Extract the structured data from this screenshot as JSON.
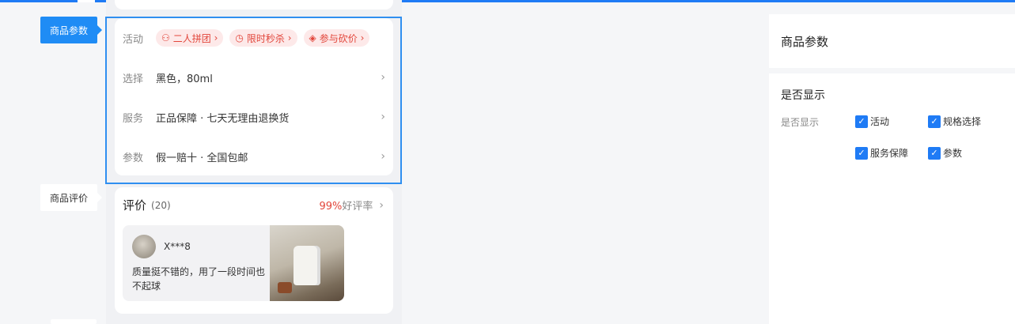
{
  "side_tags": {
    "params": "商品参数",
    "review": "商品评价"
  },
  "params_card": {
    "activity_label": "活动",
    "chips": [
      {
        "icon": "group-icon",
        "label": "二人拼团"
      },
      {
        "icon": "clock-icon",
        "label": "限时秒杀"
      },
      {
        "icon": "tag-icon",
        "label": "参与砍价"
      }
    ],
    "select_label": "选择",
    "select_value": "黑色，80ml",
    "service_label": "服务",
    "service_value": "正品保障 · 七天无理由退换货",
    "param_label": "参数",
    "param_value": "假一赔十 · 全国包邮"
  },
  "review_card": {
    "title": "评价",
    "count": "(20)",
    "rate_pct": "99%",
    "rate_text": "好评率",
    "user": "X***8",
    "text": "质量挺不错的，用了一段时间也不起球"
  },
  "right_panel": {
    "title": "商品参数",
    "section_title": "是否显示",
    "field_label": "是否显示",
    "options": [
      {
        "label": "活动",
        "checked": true
      },
      {
        "label": "规格选择",
        "checked": true
      },
      {
        "label": "服务保障",
        "checked": true
      },
      {
        "label": "参数",
        "checked": true
      }
    ]
  },
  "colors": {
    "accent": "#1f7bf5",
    "selection_border": "#2f8ff0",
    "promo_red": "#e2463b",
    "chip_bg": "#fde9e9"
  }
}
